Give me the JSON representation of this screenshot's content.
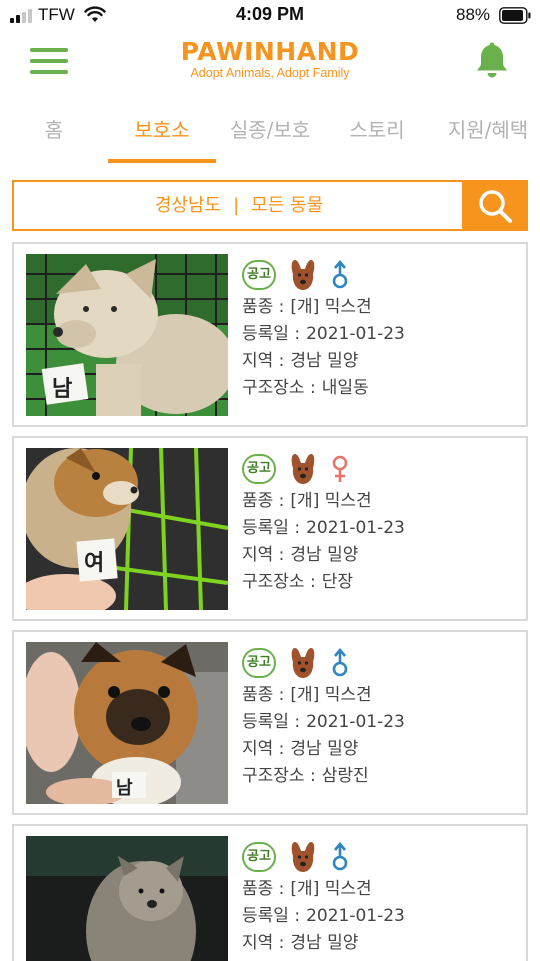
{
  "status_bar": {
    "carrier": "TFW",
    "time": "4:09 PM",
    "battery": "88%"
  },
  "header": {
    "logo_title": "PAWINHAND",
    "logo_subtitle": "Adopt Animals, Adopt Family"
  },
  "tabs": [
    {
      "label": "홈",
      "active": false
    },
    {
      "label": "보호소",
      "active": true
    },
    {
      "label": "실종/보호",
      "active": false
    },
    {
      "label": "스토리",
      "active": false
    },
    {
      "label": "지원/혜택",
      "active": false
    }
  ],
  "search": {
    "region": "경상남도",
    "separator": "|",
    "animal_filter": "모든 동물"
  },
  "labels": {
    "breed": "품종 :",
    "registered": "등록일 :",
    "area": "지역 :",
    "rescue_place": "구조장소 :",
    "notice_badge": "공고"
  },
  "colors": {
    "brand_orange": "#f7941d",
    "brand_green": "#6ab04c",
    "male_blue": "#2e86c1",
    "female_red": "#e8746a",
    "dog_brown": "#a0522d"
  },
  "animals": [
    {
      "breed": "[개] 믹스견",
      "registered": "2021-01-23",
      "area": "경남 밀양",
      "rescue_place": "내일동",
      "sex": "male",
      "sex_icon": "male-icon",
      "photo_tag": "남"
    },
    {
      "breed": "[개] 믹스견",
      "registered": "2021-01-23",
      "area": "경남 밀양",
      "rescue_place": "단장",
      "sex": "female",
      "sex_icon": "female-icon",
      "photo_tag": "여"
    },
    {
      "breed": "[개] 믹스견",
      "registered": "2021-01-23",
      "area": "경남 밀양",
      "rescue_place": "삼랑진",
      "sex": "male",
      "sex_icon": "male-icon",
      "photo_tag": "남"
    },
    {
      "breed": "[개] 믹스견",
      "registered": "2021-01-23",
      "area": "경남 밀양",
      "rescue_place": "",
      "sex": "male",
      "sex_icon": "male-icon",
      "photo_tag": ""
    }
  ]
}
